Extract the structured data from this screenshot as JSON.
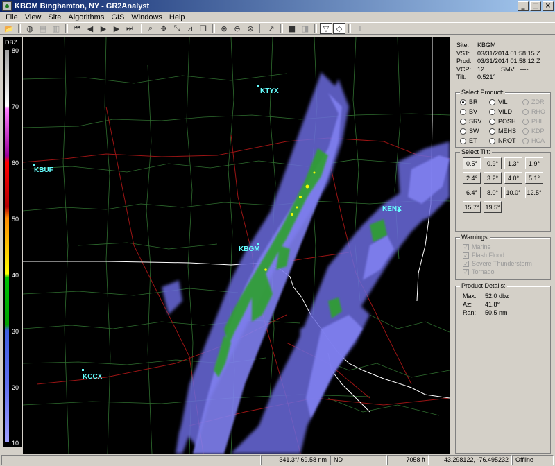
{
  "window": {
    "title": "KBGM Binghamton, NY - GR2Analyst"
  },
  "menu": [
    "File",
    "View",
    "Site",
    "Algorithms",
    "GIS",
    "Windows",
    "Help"
  ],
  "colorbar": {
    "unit": "DBZ",
    "ticks": [
      "80",
      "70",
      "60",
      "50",
      "40",
      "30",
      "20",
      "10"
    ]
  },
  "map": {
    "sites": [
      {
        "label": "KTYX"
      },
      {
        "label": "KBUF"
      },
      {
        "label": "KBGM"
      },
      {
        "label": "KENX"
      },
      {
        "label": "KCCX"
      }
    ]
  },
  "info": {
    "site_k": "Site:",
    "site_v": "KBGM",
    "vst_k": "VST:",
    "vst_v": "03/31/2014  01:58:15 Z",
    "prod_k": "Prod:",
    "prod_v": "03/31/2014  01:58:12 Z",
    "vcp_k": "VCP:",
    "vcp_v": "12",
    "smv_k": "SMV:",
    "smv_v": "----",
    "tilt_k": "Tilt:",
    "tilt_v": "0.521°"
  },
  "products": {
    "title": "Select Product:",
    "col1": [
      "BR",
      "BV",
      "SRV",
      "SW",
      "ET"
    ],
    "col2": [
      "VIL",
      "VILD",
      "POSH",
      "MEHS",
      "NROT"
    ],
    "col3": [
      "ZDR",
      "RHO",
      "PHI",
      "KDP",
      "HCA"
    ]
  },
  "tilts": {
    "title": "Select Tilt:",
    "values": [
      "0.5°",
      "0.9°",
      "1.3°",
      "1.9°",
      "2.4°",
      "3.2°",
      "4.0°",
      "5.1°",
      "6.4°",
      "8.0°",
      "10.0°",
      "12.5°",
      "15.7°",
      "19.5°"
    ]
  },
  "warnings": {
    "title": "Warnings:",
    "items": [
      "Marine",
      "Flash Flood",
      "Severe Thunderstorm",
      "Tornado"
    ]
  },
  "details": {
    "title": "Product Details:",
    "max_k": "Max:",
    "max_v": "52.0 dbz",
    "az_k": "Az:",
    "az_v": "41.8°",
    "ran_k": "Ran:",
    "ran_v": "50.5 nm"
  },
  "status": {
    "bearing": "341.3°/ 69.58 nm",
    "nd": "ND",
    "height": "7058 ft",
    "coords": "43.298122, -76.495232",
    "mode": "Offline"
  },
  "colors": {
    "site_label": "#66ffff",
    "border_state": "#ffffff",
    "county": "#3a7a3a",
    "road": "#a01818"
  }
}
